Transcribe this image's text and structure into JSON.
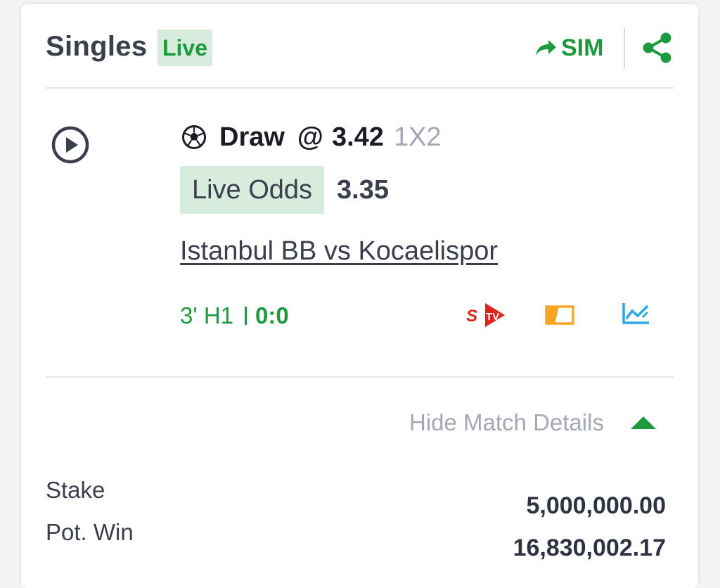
{
  "header": {
    "title": "Singles",
    "live_badge": "Live",
    "sim_label": "SIM"
  },
  "selection": {
    "name": "Draw",
    "at": "@",
    "odds": "3.42",
    "market": "1X2",
    "live_odds_label": "Live Odds",
    "live_odds_value": "3.35",
    "match": "Istanbul BB vs Kocaelispor",
    "time": "3' H1",
    "score": "0:0",
    "icons": [
      "play-icon",
      "football-icon",
      "stv-icon",
      "match-tracker-icon",
      "stats-chart-icon"
    ]
  },
  "details_toggle": {
    "label": "Hide Match Details"
  },
  "summary": {
    "stake_label": "Stake",
    "stake_value": "5,000,000.00",
    "pot_win_label": "Pot. Win",
    "pot_win_value": "16,830,002.17"
  },
  "colors": {
    "accent_green": "#1d9a3e",
    "badge_bg": "#d7ecdd",
    "stv_red": "#e2231a",
    "tracker_yellow": "#f5a623",
    "stats_blue": "#29a9e0"
  }
}
